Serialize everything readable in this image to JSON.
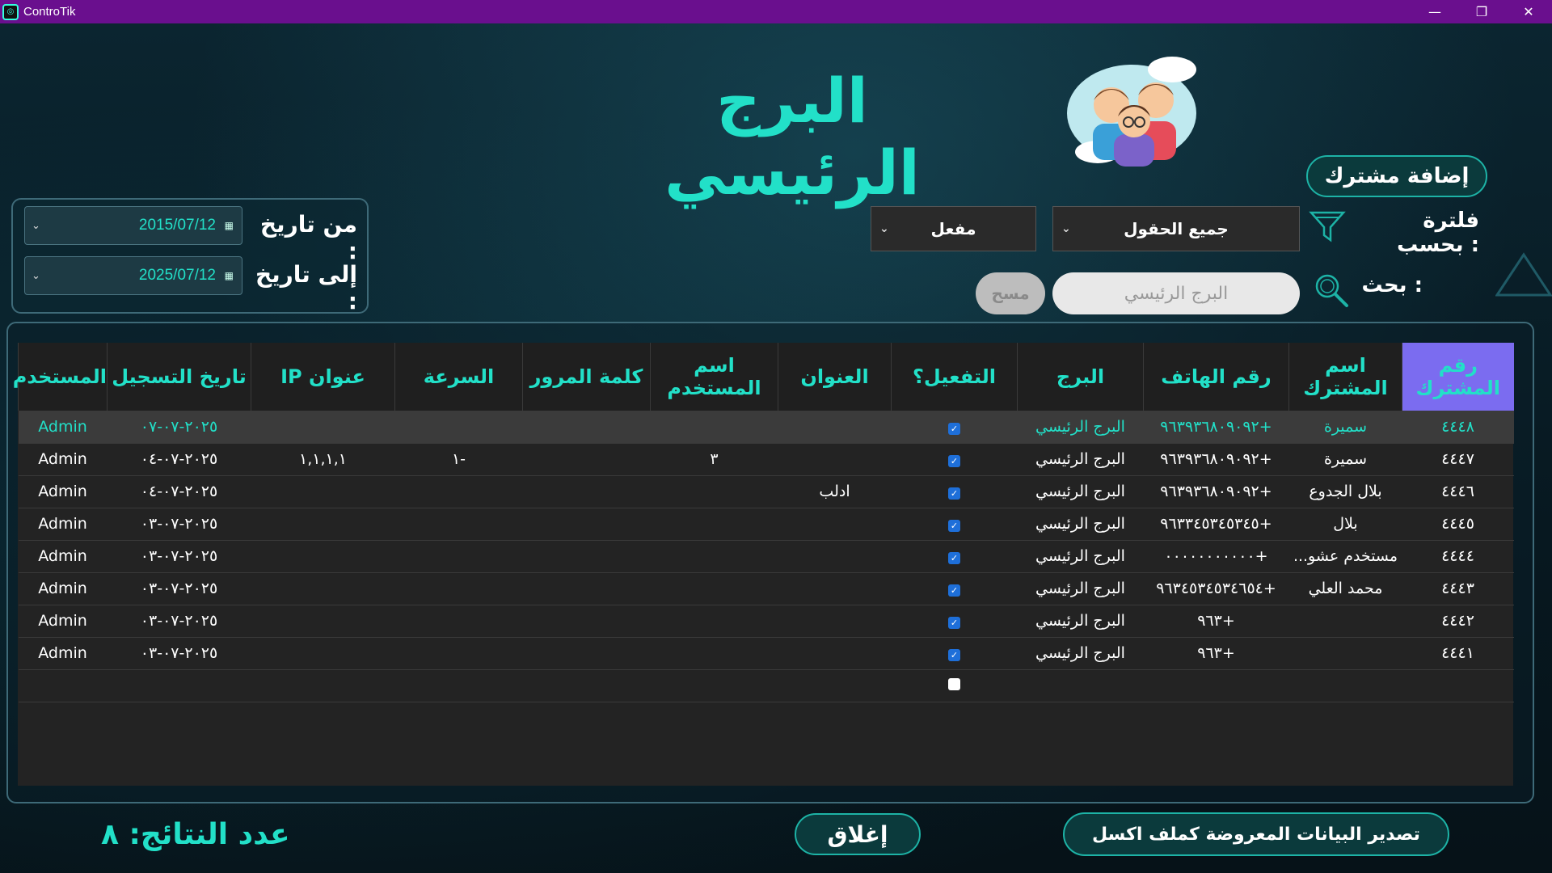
{
  "window": {
    "title": "ControTik",
    "minimize": "—",
    "restore": "❐",
    "close": "✕"
  },
  "header": {
    "title": "البرج الرئيسي"
  },
  "toolbar": {
    "add_label": "إضافة مشترك",
    "filter_label": "فلترة بحسب :",
    "filter_field": "جميع الحقول",
    "filter_status": "مفعل",
    "search_label": "بحث :",
    "search_value": "البرج الرئيسي",
    "clear_label": "مسح"
  },
  "dates": {
    "from_label": "من تاريخ :",
    "from_value": "2015/07/12",
    "to_label": "إلى تاريخ :",
    "to_value": "2025/07/12"
  },
  "table": {
    "headers": [
      "رقم المشترك",
      "اسم المشترك",
      "رقم الهاتف",
      "البرج",
      "التفعيل؟",
      "العنوان",
      "اسم المستخدم",
      "كلمة المرور",
      "السرعة",
      "عنوان IP",
      "تاريخ التسجيل",
      "المستخدم"
    ],
    "rows": [
      {
        "id": "٤٤٤٨",
        "name": "سميرة",
        "phone": "+٩٦٣٩٣٦٨٠٩٠٩٢",
        "tower": "البرج الرئيسي",
        "active": true,
        "address": "",
        "username": "",
        "password": "",
        "speed": "",
        "ip": "",
        "date": "٢٠٢٥-٠٧-٠٧",
        "user": "Admin"
      },
      {
        "id": "٤٤٤٧",
        "name": "سميرة",
        "phone": "+٩٦٣٩٣٦٨٠٩٠٩٢",
        "tower": "البرج الرئيسي",
        "active": true,
        "address": "",
        "username": "٣",
        "password": "",
        "speed": "-١",
        "ip": "١,١,١,١",
        "date": "٢٠٢٥-٠٧-٠٤",
        "user": "Admin"
      },
      {
        "id": "٤٤٤٦",
        "name": "بلال الجدوع",
        "phone": "+٩٦٣٩٣٦٨٠٩٠٩٢",
        "tower": "البرج الرئيسي",
        "active": true,
        "address": "ادلب",
        "username": "",
        "password": "",
        "speed": "",
        "ip": "",
        "date": "٢٠٢٥-٠٧-٠٤",
        "user": "Admin"
      },
      {
        "id": "٤٤٤٥",
        "name": "بلال",
        "phone": "+٩٦٣٣٤٥٣٤٥٣٤٥",
        "tower": "البرج الرئيسي",
        "active": true,
        "address": "",
        "username": "",
        "password": "",
        "speed": "",
        "ip": "",
        "date": "٢٠٢٥-٠٧-٠٣",
        "user": "Admin"
      },
      {
        "id": "٤٤٤٤",
        "name": "مستخدم عشو...",
        "phone": "+٠٠٠٠٠٠٠٠٠٠٠",
        "tower": "البرج الرئيسي",
        "active": true,
        "address": "",
        "username": "",
        "password": "",
        "speed": "",
        "ip": "",
        "date": "٢٠٢٥-٠٧-٠٣",
        "user": "Admin"
      },
      {
        "id": "٤٤٤٣",
        "name": "محمد العلي",
        "phone": "+٩٦٣٤٥٣٤٥٣٤٦٥٤",
        "tower": "البرج الرئيسي",
        "active": true,
        "address": "",
        "username": "",
        "password": "",
        "speed": "",
        "ip": "",
        "date": "٢٠٢٥-٠٧-٠٣",
        "user": "Admin"
      },
      {
        "id": "٤٤٤٢",
        "name": "",
        "phone": "+٩٦٣",
        "tower": "البرج الرئيسي",
        "active": true,
        "address": "",
        "username": "",
        "password": "",
        "speed": "",
        "ip": "",
        "date": "٢٠٢٥-٠٧-٠٣",
        "user": "Admin"
      },
      {
        "id": "٤٤٤١",
        "name": "",
        "phone": "+٩٦٣",
        "tower": "البرج الرئيسي",
        "active": true,
        "address": "",
        "username": "",
        "password": "",
        "speed": "",
        "ip": "",
        "date": "٢٠٢٥-٠٧-٠٣",
        "user": "Admin"
      },
      {
        "id": "",
        "name": "",
        "phone": "",
        "tower": "",
        "active": false,
        "address": "",
        "username": "",
        "password": "",
        "speed": "",
        "ip": "",
        "date": "",
        "user": ""
      }
    ]
  },
  "footer": {
    "count_label": "عدد النتائج: ٨",
    "close_label": "إغلاق",
    "export_label": "تصدير البيانات المعروضة كملف اكسل"
  },
  "colors": {
    "accent": "#22e0c8",
    "titlebar": "#6a0f8e",
    "active_header": "#7b6cf0",
    "checkbox": "#1e6fd9"
  },
  "icons": {
    "filter": "funnel-icon",
    "search": "magnifier-icon",
    "calendar": "calendar-icon",
    "dropdown": "chevron-down-icon"
  }
}
